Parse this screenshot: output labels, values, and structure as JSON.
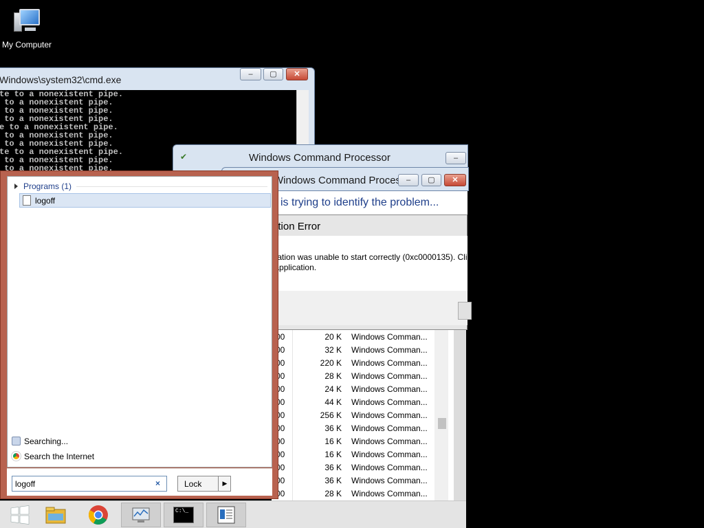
{
  "desktop": {
    "icon_label": "My Computer"
  },
  "cmd": {
    "title": "Windows\\system32\\cmd.exe",
    "lines": [
      "te to a nonexistent pipe.",
      " to a nonexistent pipe.",
      " to a nonexistent pipe.",
      " to a nonexistent pipe.",
      "e to a nonexistent pipe.",
      " to a nonexistent pipe.",
      " to a nonexistent pipe.",
      "te to a nonexistent pipe.",
      " to a nonexistent pipe.",
      " to a nonexistent pipe."
    ]
  },
  "processor1": {
    "title": "Windows Command Processor"
  },
  "processor2": {
    "title": "Windows Command Processor"
  },
  "wer": {
    "message": "is trying to identify the problem..."
  },
  "app_error": {
    "title": "cmd.exe - Application Error",
    "line1": "The application was unable to start correctly (0xc0000135). Clic",
    "line2": "close the application."
  },
  "tasklist": {
    "rows": [
      {
        "a": "00",
        "mem": "20 K",
        "name": "Windows Comman..."
      },
      {
        "a": "00",
        "mem": "32 K",
        "name": "Windows Comman..."
      },
      {
        "a": "00",
        "mem": "220 K",
        "name": "Windows Comman..."
      },
      {
        "a": "00",
        "mem": "28 K",
        "name": "Windows Comman..."
      },
      {
        "a": "00",
        "mem": "24 K",
        "name": "Windows Comman..."
      },
      {
        "a": "00",
        "mem": "44 K",
        "name": "Windows Comman..."
      },
      {
        "a": "00",
        "mem": "256 K",
        "name": "Windows Comman..."
      },
      {
        "a": "00",
        "mem": "36 K",
        "name": "Windows Comman..."
      },
      {
        "a": "00",
        "mem": "16 K",
        "name": "Windows Comman..."
      },
      {
        "a": "00",
        "mem": "16 K",
        "name": "Windows Comman..."
      },
      {
        "a": "00",
        "mem": "36 K",
        "name": "Windows Comman..."
      },
      {
        "a": "00",
        "mem": "36 K",
        "name": "Windows Comman..."
      },
      {
        "a": "00",
        "mem": "28 K",
        "name": "Windows Comman..."
      }
    ]
  },
  "start_menu": {
    "section": "Programs (1)",
    "result": "logoff",
    "searching": "Searching...",
    "internet": "Search the Internet",
    "search_value": "logoff",
    "clear_glyph": "×",
    "power_button": "Lock",
    "power_arrow": "▶"
  },
  "window_buttons": {
    "minimize": "‒",
    "maximize": "▢",
    "close": "✕"
  },
  "taskbar": {
    "items": [
      "start-icon",
      "file-explorer-icon",
      "chrome-icon",
      "resource-monitor-icon",
      "cmd-icon",
      "document-icon"
    ],
    "cmd_glyph": "C:\\_"
  },
  "colors": {
    "start_frame": "#b8624f",
    "error_red": "#c81818",
    "link_blue": "#1e3e8a"
  }
}
